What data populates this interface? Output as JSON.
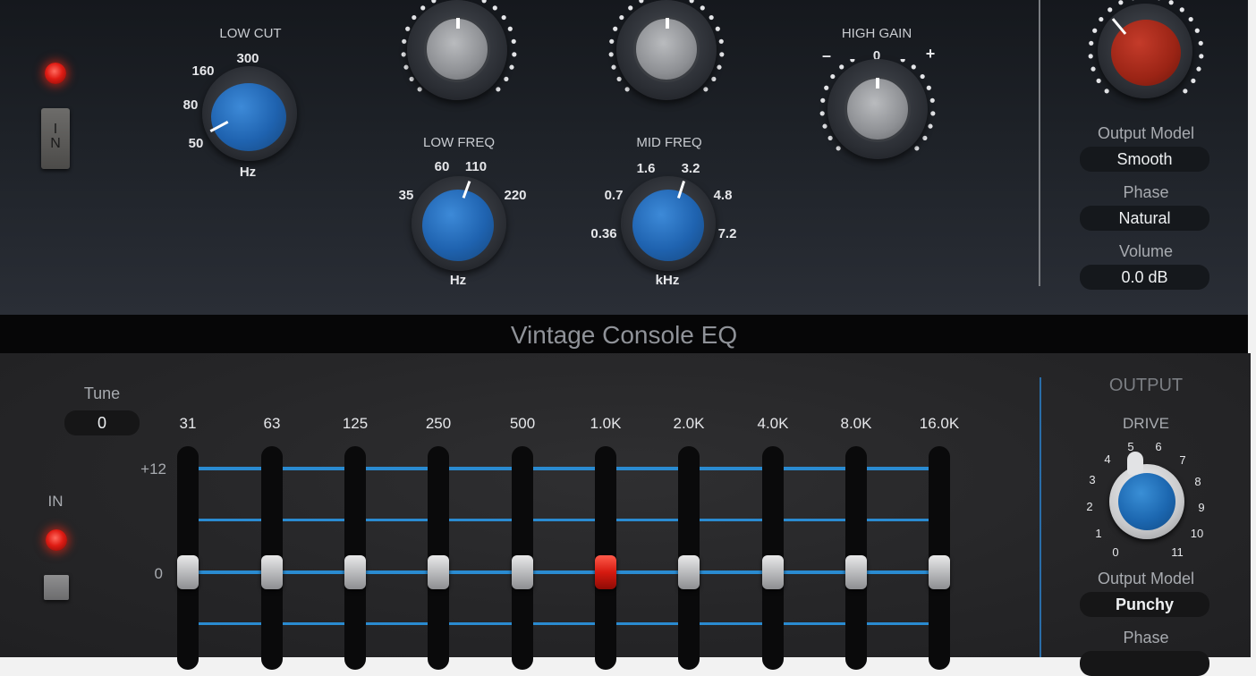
{
  "plugin_title": "Vintage Console EQ",
  "top": {
    "low_cut": {
      "label": "LOW CUT",
      "scale": [
        "160",
        "300",
        "80",
        "50"
      ],
      "unit": "Hz"
    },
    "low_freq": {
      "label": "LOW FREQ",
      "scale": [
        "60",
        "110",
        "35",
        "220"
      ],
      "unit": "Hz"
    },
    "mid_freq": {
      "label": "MID FREQ",
      "scale": [
        "1.6",
        "3.2",
        "0.7",
        "4.8",
        "0.36",
        "7.2"
      ],
      "unit": "kHz"
    },
    "high_gain": {
      "label": "HIGH GAIN",
      "minus": "–",
      "zero": "0",
      "plus": "+"
    },
    "power_switch_label": "I\nN",
    "output_model_label": "Output Model",
    "output_model_value": "Smooth",
    "phase_label": "Phase",
    "phase_value": "Natural",
    "volume_label": "Volume",
    "volume_value": "0.0 dB"
  },
  "bottom": {
    "tune_label": "Tune",
    "tune_value": "0",
    "in_label": "IN",
    "scale_top": "+12",
    "scale_zero": "0",
    "bands": [
      "31",
      "63",
      "125",
      "250",
      "500",
      "1.0K",
      "2.0K",
      "4.0K",
      "8.0K",
      "16.0K"
    ],
    "output_title": "OUTPUT",
    "drive_label": "DRIVE",
    "drive_scale": [
      "0",
      "1",
      "2",
      "3",
      "4",
      "5",
      "6",
      "7",
      "8",
      "9",
      "10",
      "11"
    ],
    "output_model_label": "Output Model",
    "output_model_value": "Punchy",
    "phase_label": "Phase"
  },
  "colors": {
    "accent_blue": "#2a8bd1",
    "led_red": "#e01c14",
    "knob_red": "#9b2415"
  }
}
